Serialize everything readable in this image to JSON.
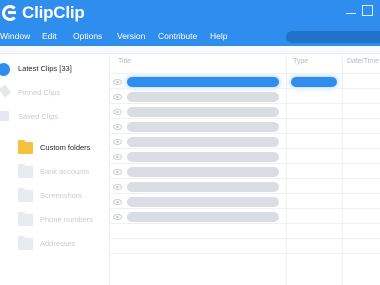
{
  "app": {
    "title": "ClipClip"
  },
  "menu": {
    "items": [
      {
        "label": "Window"
      },
      {
        "label": "Edit"
      },
      {
        "label": "Options"
      },
      {
        "label": "Version"
      },
      {
        "label": "Contribute"
      },
      {
        "label": "Help"
      }
    ]
  },
  "sidebar": {
    "items": [
      {
        "label": "Latest Clips [33]",
        "icon": "latest-clips-icon",
        "active": true
      },
      {
        "label": "Pinned Clips",
        "icon": "pin-icon"
      },
      {
        "label": "Saved Clips",
        "icon": "save-icon"
      },
      {
        "label": "Custom folders",
        "icon": "folder-icon",
        "active": true
      },
      {
        "label": "Bank accounts",
        "icon": "folder-icon"
      },
      {
        "label": "Screenshots",
        "icon": "folder-icon"
      },
      {
        "label": "Phone numbers",
        "icon": "folder-icon"
      },
      {
        "label": "Addresses",
        "icon": "folder-icon"
      }
    ]
  },
  "table": {
    "columns": [
      "Title",
      "Type",
      "Date/Time"
    ],
    "row_count": 10,
    "selected_row": 1
  },
  "colors": {
    "accent": "#2f8ded",
    "folder": "#f7c23b",
    "placeholder": "#dadde3"
  }
}
